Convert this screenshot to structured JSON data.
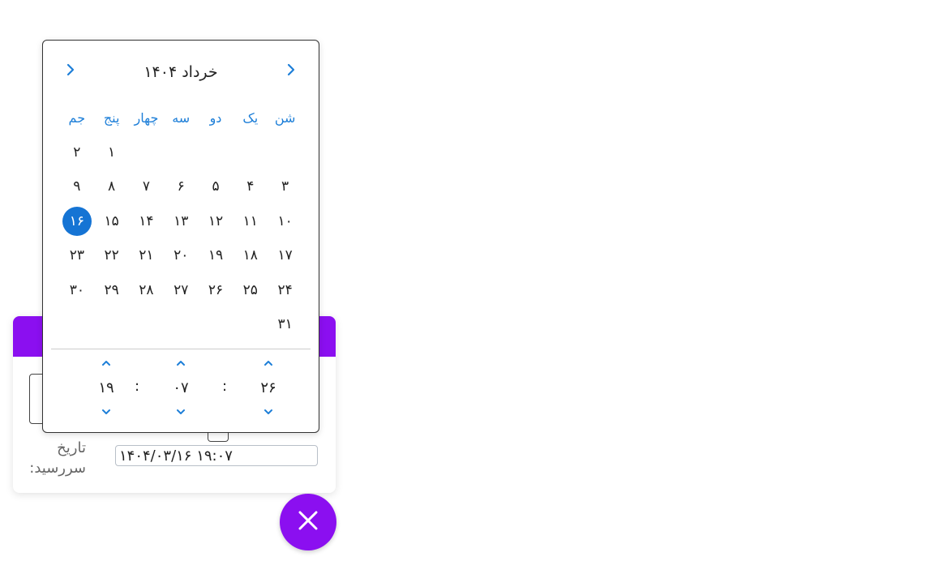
{
  "colors": {
    "accent": "#8b0ff0",
    "selected_day": "#1574d4",
    "nav_blue": "#1e7fd8"
  },
  "form": {
    "due_label": "تاریخ سررسید:",
    "due_value": "۱۴۰۴/۰۳/۱۶ ۱۹:۰۷"
  },
  "picker": {
    "month_title": "خرداد ۱۴۰۴",
    "prev_icon": "chevron-left-icon",
    "next_icon": "chevron-right-icon",
    "weekdays": [
      "شن",
      "یک",
      "دو",
      "سه",
      "چهار",
      "پنج",
      "جم"
    ],
    "leading_blanks": 5,
    "days": [
      "۱",
      "۲",
      "۳",
      "۴",
      "۵",
      "۶",
      "۷",
      "۸",
      "۹",
      "۱۰",
      "۱۱",
      "۱۲",
      "۱۳",
      "۱۴",
      "۱۵",
      "۱۶",
      "۱۷",
      "۱۸",
      "۱۹",
      "۲۰",
      "۲۱",
      "۲۲",
      "۲۳",
      "۲۴",
      "۲۵",
      "۲۶",
      "۲۷",
      "۲۸",
      "۲۹",
      "۳۰",
      "۳۱"
    ],
    "selected_day_index": 15,
    "time": {
      "seconds": "۲۶",
      "minutes": "۰۷",
      "hours": "۱۹",
      "separator": ":"
    }
  },
  "fab": {
    "icon": "close-icon"
  }
}
